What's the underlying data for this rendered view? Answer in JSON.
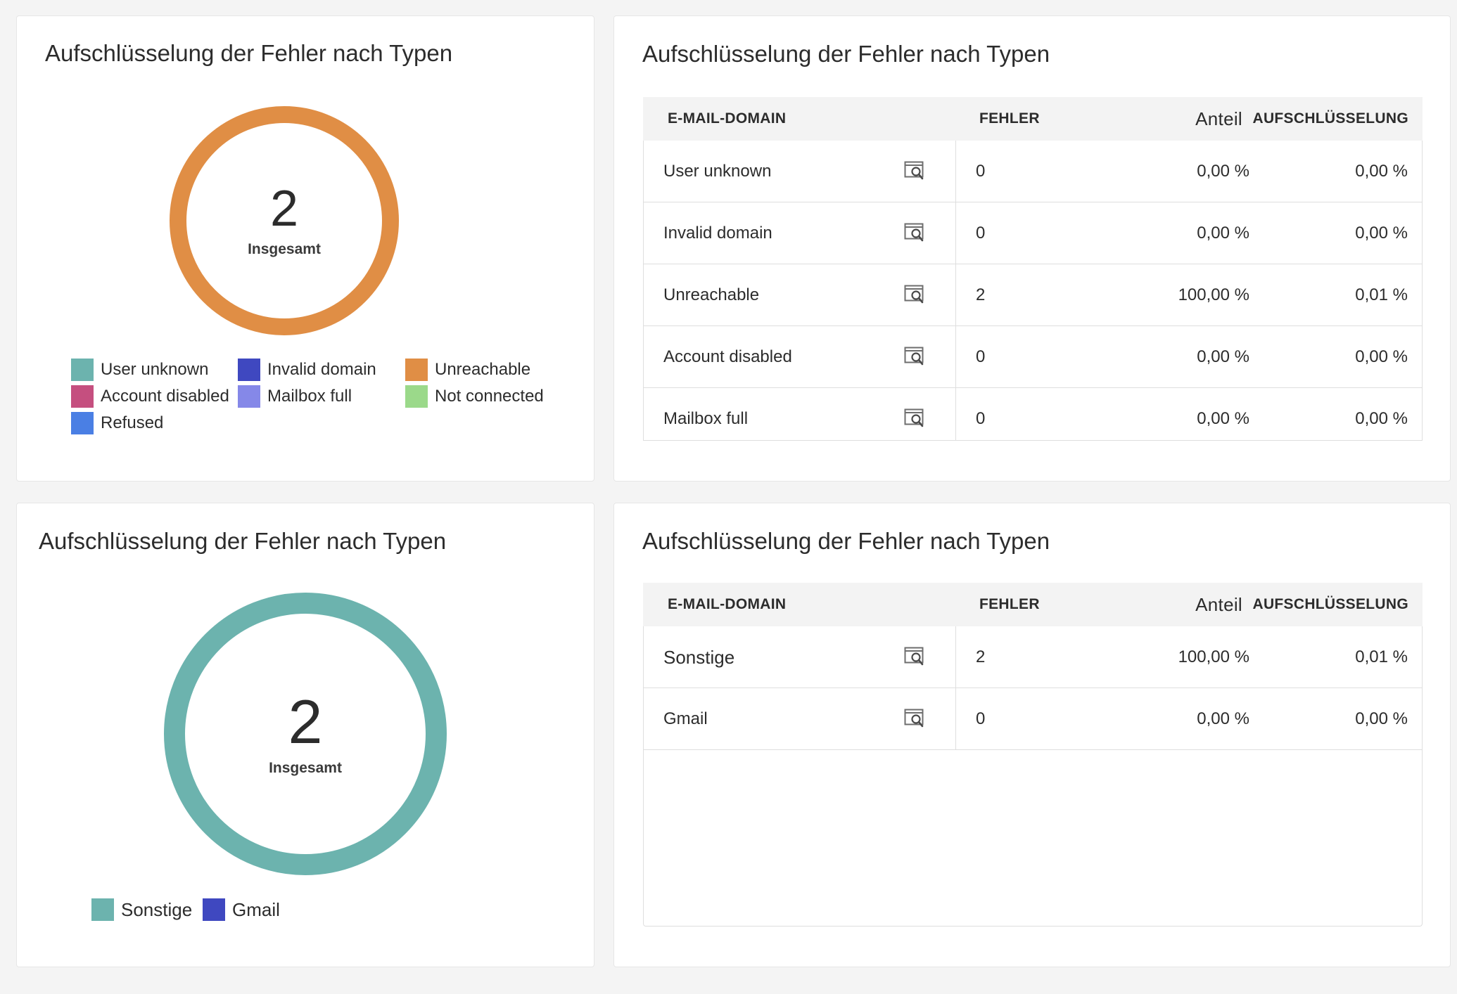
{
  "panels": {
    "top_left": {
      "title": "Aufschlüsselung der Fehler nach Typen",
      "donut": {
        "value": "2",
        "label": "Insgesamt",
        "color": "#e08e45"
      },
      "legend": [
        {
          "label": "User unknown",
          "color": "#6cb3ae"
        },
        {
          "label": "Invalid domain",
          "color": "#3f48c0"
        },
        {
          "label": "Unreachable",
          "color": "#e08e45"
        },
        {
          "label": "Account disabled",
          "color": "#c54f7f"
        },
        {
          "label": "Mailbox full",
          "color": "#8588e8"
        },
        {
          "label": "Not connected",
          "color": "#9bd98a"
        },
        {
          "label": "Refused",
          "color": "#4a7fe4"
        }
      ]
    },
    "top_right": {
      "title": "Aufschlüsselung der Fehler nach Typen",
      "columns": {
        "domain": "E-MAIL-DOMAIN",
        "errors": "FEHLER",
        "share": "Anteil",
        "breakdown": "AUFSCHLÜSSELUNG"
      },
      "rows": [
        {
          "name": "User unknown",
          "errors": "0",
          "share": "0,00 %",
          "breakdown": "0,00 %"
        },
        {
          "name": "Invalid domain",
          "errors": "0",
          "share": "0,00 %",
          "breakdown": "0,00 %"
        },
        {
          "name": "Unreachable",
          "errors": "2",
          "share": "100,00 %",
          "breakdown": "0,01 %"
        },
        {
          "name": "Account disabled",
          "errors": "0",
          "share": "0,00 %",
          "breakdown": "0,00 %"
        },
        {
          "name": "Mailbox full",
          "errors": "0",
          "share": "0,00 %",
          "breakdown": "0,00 %"
        }
      ]
    },
    "bottom_left": {
      "title": "Aufschlüsselung der Fehler nach Typen",
      "donut": {
        "value": "2",
        "label": "Insgesamt",
        "color": "#6cb3ae"
      },
      "legend": [
        {
          "label": "Sonstige",
          "color": "#6cb3ae"
        },
        {
          "label": "Gmail",
          "color": "#3f48c0"
        }
      ]
    },
    "bottom_right": {
      "title": "Aufschlüsselung der Fehler nach Typen",
      "columns": {
        "domain": "E-MAIL-DOMAIN",
        "errors": "FEHLER",
        "share": "Anteil",
        "breakdown": "AUFSCHLÜSSELUNG"
      },
      "rows": [
        {
          "name": "Sonstige",
          "errors": "2",
          "share": "100,00 %",
          "breakdown": "0,01 %"
        },
        {
          "name": "Gmail",
          "errors": "0",
          "share": "0,00 %",
          "breakdown": "0,00 %"
        }
      ]
    }
  }
}
